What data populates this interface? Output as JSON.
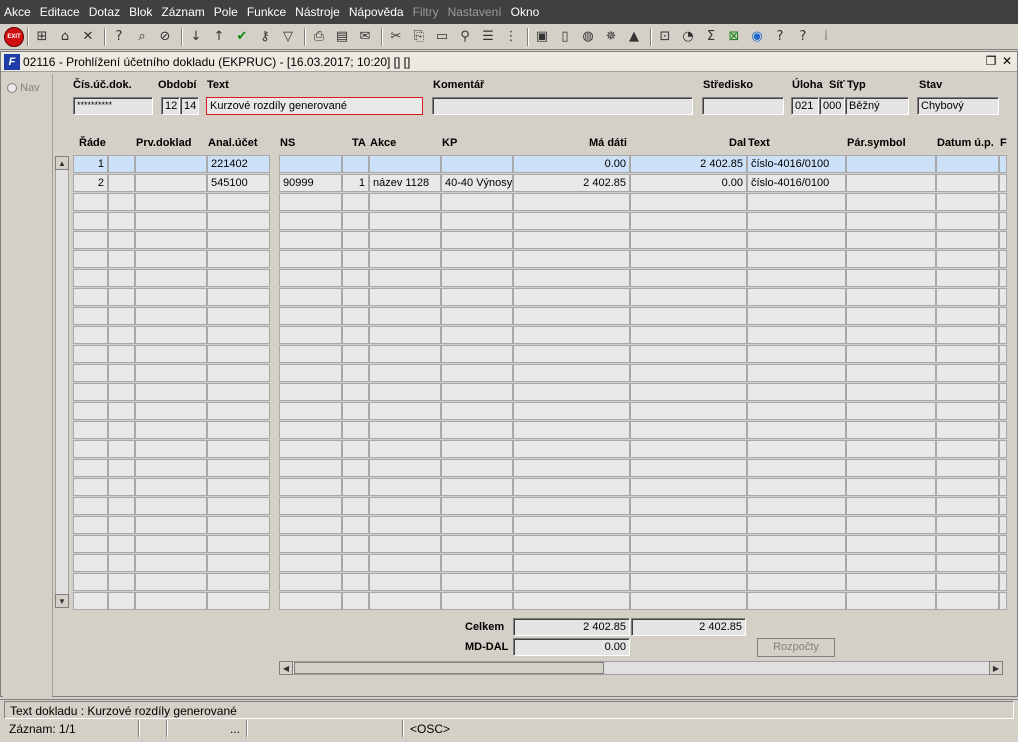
{
  "menu": [
    "Akce",
    "Editace",
    "Dotaz",
    "Blok",
    "Záznam",
    "Pole",
    "Funkce",
    "Nástroje",
    "Nápověda",
    "Filtry",
    "Nastavení",
    "Okno"
  ],
  "menu_disabled": [
    "Filtry",
    "Nastavení"
  ],
  "toolbar": {
    "exit_label": "EXIT"
  },
  "window": {
    "title": "02116 - Prohlížení účetního dokladu (EKPRUC) - [16.03.2017; 10:20] [] []",
    "logo": "F"
  },
  "nav": {
    "label": "Nav"
  },
  "header": {
    "labels": {
      "cis": "Čís.úč.dok.",
      "obdobi": "Období",
      "text": "Text",
      "komentar": "Komentář",
      "stredisko": "Středisko",
      "uloha": "Úloha",
      "sit": "Síť",
      "typ": "Typ",
      "stav": "Stav"
    },
    "values": {
      "cis": "**********",
      "obdobi_a": "12",
      "obdobi_b": "14",
      "text": "Kurzové rozdíly generované",
      "komentar": "",
      "stredisko": "",
      "uloha": "021",
      "sit": "000",
      "typ": "Běžný",
      "stav": "Chybový"
    }
  },
  "table": {
    "headers": {
      "rade": "Řáde",
      "prv": "Prv.doklad",
      "anal": "Anal.účet",
      "ns": "NS",
      "ta": "TA",
      "akce": "Akce",
      "kp": "KP",
      "ma": "Má dáti",
      "dal": "Dal",
      "text": "Text",
      "par": "Pár.symbol",
      "datum": "Datum ú.p.",
      "extra": "F"
    },
    "rows": [
      {
        "rade": "1",
        "prv": "",
        "anal": "221402",
        "ns": "",
        "ta": "",
        "akce": "",
        "kp": "",
        "ma": "0.00",
        "dal": "2 402.85",
        "text": "číslo-4016/0100",
        "par": "",
        "datum": ""
      },
      {
        "rade": "2",
        "prv": "",
        "anal": "545100",
        "ns": "90999",
        "ta": "1",
        "akce": "název 1128",
        "kp": "40-40 Výnosy",
        "ma": "2 402.85",
        "dal": "0.00",
        "text": "číslo-4016/0100",
        "par": "",
        "datum": ""
      }
    ]
  },
  "totals": {
    "celkem_label": "Celkem",
    "celkem_ma": "2 402.85",
    "celkem_dal": "2 402.85",
    "mddal_label": "MD-DAL",
    "mddal_value": "0.00",
    "rozpocty_label": "Rozpočty"
  },
  "status": {
    "line1": "Text dokladu : Kurzové rozdíly generované",
    "zaznam": "Záznam: 1/1",
    "dots": "...",
    "osc": "<OSC>"
  }
}
